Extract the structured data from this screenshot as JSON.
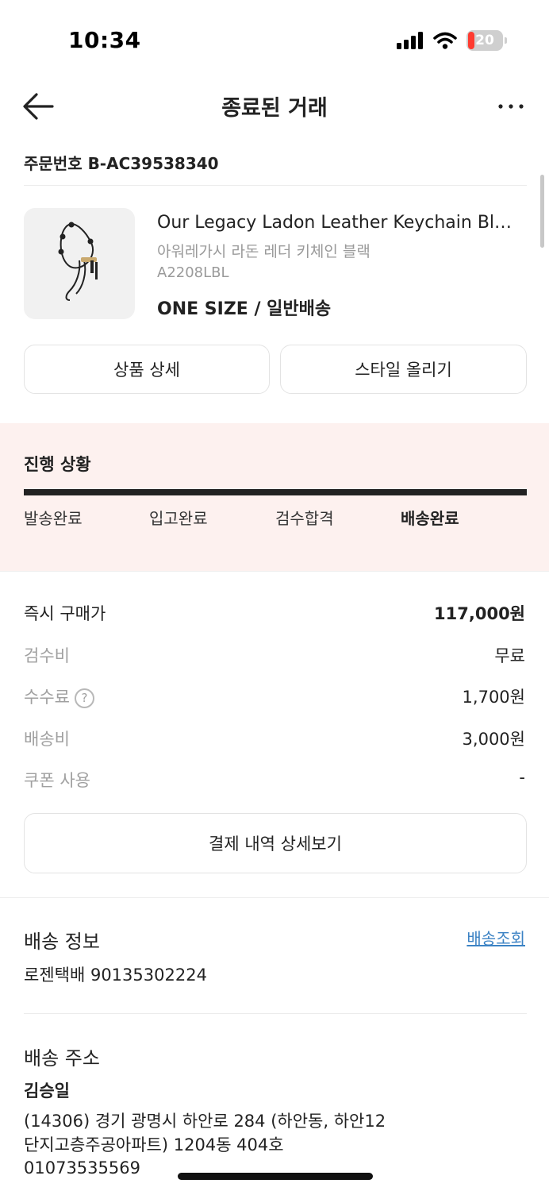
{
  "status_bar": {
    "time": "10:34",
    "battery": "20",
    "battery_level": 0.2,
    "battery_color": "#ff3b30",
    "icons": [
      "signal-icon",
      "wifi-icon",
      "battery-icon"
    ]
  },
  "nav": {
    "title": "종료된 거래",
    "back_icon": "back-arrow-icon",
    "more_icon": "more-dots-icon"
  },
  "order": {
    "number": "주문번호 B-AC39538340"
  },
  "product": {
    "name": "Our Legacy Ladon Leather Keychain Black",
    "name_kr": "아워레가시 라돈 레더 키체인 블랙",
    "code": "A2208LBL",
    "option": "ONE SIZE / 일반배송"
  },
  "buttons": {
    "detail": "상품 상세",
    "style": "스타일 올리기"
  },
  "progress": {
    "title": "진행 상황",
    "steps": [
      "발송완료",
      "입고완료",
      "검수합격",
      "배송완료"
    ],
    "current_step": "배송완료",
    "completion": 1.0,
    "background": "#fdf1ef"
  },
  "payment": {
    "rows": [
      {
        "label": "즉시 구매가",
        "value": "117,000원"
      },
      {
        "label": "검수비",
        "value": "무료"
      },
      {
        "label": "수수료",
        "value": "1,700원"
      },
      {
        "label": "배송비",
        "value": "3,000원"
      },
      {
        "label": "쿠폰 사용",
        "value": "-"
      }
    ],
    "help_glyph": "?",
    "detail_button": "결제 내역 상세보기"
  },
  "shipping": {
    "title": "배송 정보",
    "track_link": "배송조회",
    "tracking": "로젠택배 90135302224"
  },
  "address": {
    "title": "배송 주소",
    "name": "김승일",
    "line1": "(14306) 경기 광명시 하안로 284 (하안동, 하안12",
    "line2": "단지고층주공아파트) 1204동 404호",
    "phone": "01073535569"
  },
  "colors": {
    "link": "#3b82c4",
    "text": "#222222",
    "muted": "#a0a0a0"
  }
}
